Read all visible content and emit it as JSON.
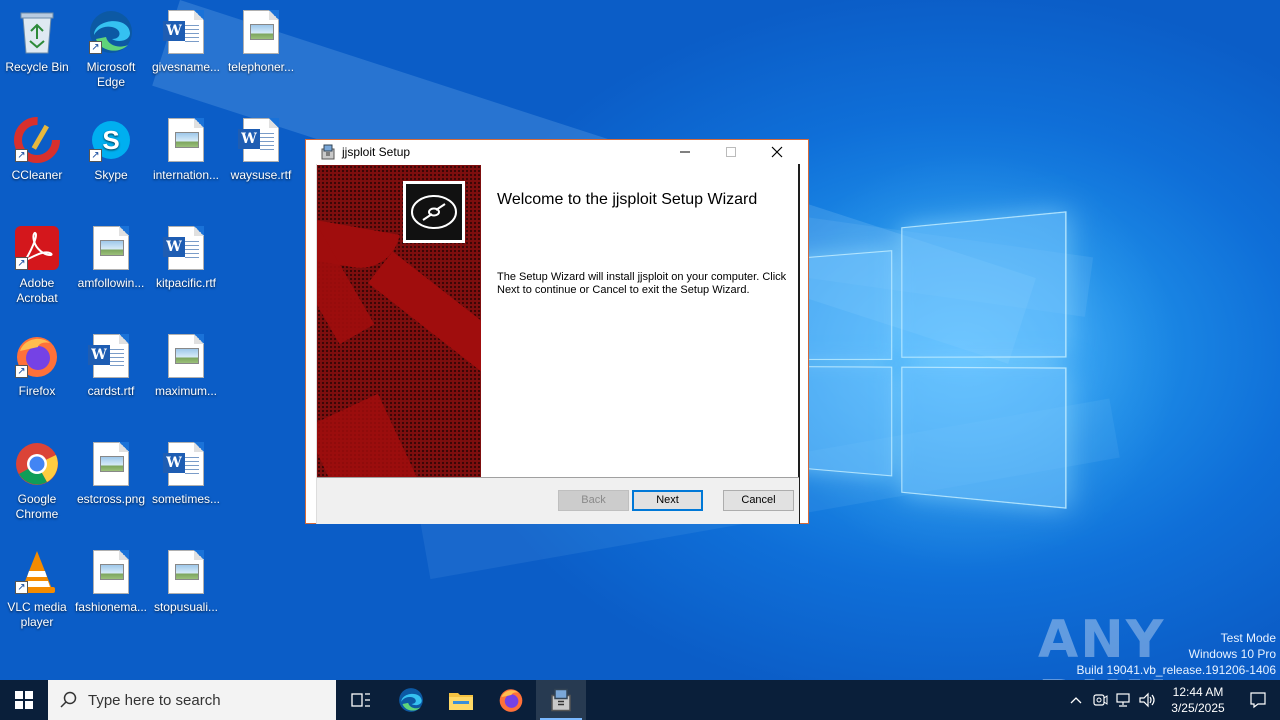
{
  "desktop": {
    "icons": [
      {
        "label": "Recycle Bin"
      },
      {
        "label": "Microsoft Edge"
      },
      {
        "label": "givesname..."
      },
      {
        "label": "telephoner..."
      },
      {
        "label": "CCleaner"
      },
      {
        "label": "Skype"
      },
      {
        "label": "internation..."
      },
      {
        "label": "waysuse.rtf"
      },
      {
        "label": "Adobe Acrobat"
      },
      {
        "label": "amfollowin..."
      },
      {
        "label": "kitpacific.rtf"
      },
      {
        "label": "Firefox"
      },
      {
        "label": "cardst.rtf"
      },
      {
        "label": "maximum..."
      },
      {
        "label": "Google Chrome"
      },
      {
        "label": "estcross.png"
      },
      {
        "label": "sometimes..."
      },
      {
        "label": "VLC media player"
      },
      {
        "label": "fashionema..."
      },
      {
        "label": "stopusuali..."
      }
    ]
  },
  "setup": {
    "title": "jjsploit Setup",
    "heading": "Welcome to the jjsploit Setup Wizard",
    "body": "The Setup Wizard will install jjsploit on your computer. Click Next to continue or Cancel to exit the Setup Wizard.",
    "back_label": "Back",
    "next_label": "Next",
    "cancel_label": "Cancel"
  },
  "watermark": {
    "brand": "ANY RUN",
    "line1": "Test Mode",
    "line2": "Windows 10 Pro",
    "line3": "Build 19041.vb_release.191206-1406"
  },
  "taskbar": {
    "search_placeholder": "Type here to search",
    "time": "12:44 AM",
    "date": "3/25/2025"
  },
  "colors": {
    "desktop_blue": "#0f6fd8",
    "banner_red": "#7e0e0e",
    "taskbar": "#0a1f3a",
    "accent": "#0078d7"
  }
}
